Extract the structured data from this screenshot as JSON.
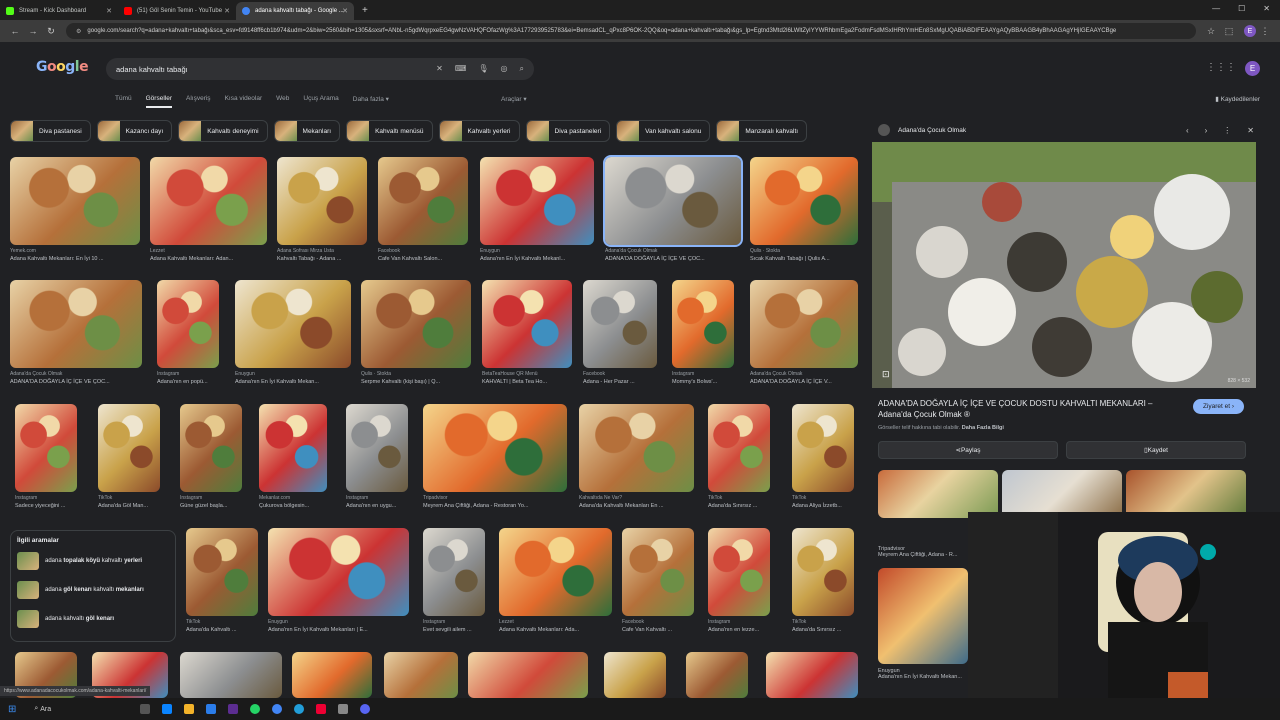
{
  "browser": {
    "tabs": [
      {
        "title": "Stream - Kick Dashboard",
        "color": "#53fc18",
        "active": false
      },
      {
        "title": "(51) Göl Senin Temin - YouTube",
        "color": "#ff0000",
        "active": false
      },
      {
        "title": "adana kahvaltı tabağı - Google ...",
        "color": "#4285f4",
        "active": true
      }
    ],
    "url": "google.com/search?q=adana+kahvaltı+tabağı&sca_esv=fd9148ff6cb1b974&udm=2&biw=2560&bih=1305&sxsrf=ANbL-n5gdWqrpxeEG4gwNzVAHQFOfazWg%3A1772939525783&ei=BemsadCL_qPxc8P6OK-2QQ&oq=adana+kahvaltı+tabağı&gs_lp=Egtnd3Mtd2l6LWltZyIYYWRhbmEga2FodmFsdMSxIHRhYmHEn8SxMgUQABiABDIFEAAYgAQyBBAAGB4yBhAAGAgYHjIGEAAYCBge",
    "new_tab": "+",
    "profile_letter": "E"
  },
  "google": {
    "logo": "Google",
    "query": "adana kahvaltı tabağı",
    "tabs": [
      "Tümü",
      "Görseller",
      "Alışveriş",
      "Kısa videolar",
      "Web",
      "Uçuş Arama",
      "Daha fazla ▾"
    ],
    "selected_tab": "Görseller",
    "tools": "Araçlar ▾",
    "saved": "Kaydedilenler",
    "avatar_letter": "E"
  },
  "chips": [
    "Diva pastanesi",
    "Kazancı dayı",
    "Kahvaltı deneyimi",
    "Mekanları",
    "Kahvaltı menüsü",
    "Kahvaltı yerleri",
    "Diva pastaneleri",
    "Van kahvaltı salonu",
    "Manzaralı kahvaltı"
  ],
  "results": [
    {
      "src": "Yemek.com",
      "title": "Adana Kahvaltı Mekanları: En İyi 10 ..."
    },
    {
      "src": "Lezzet",
      "title": "Adana Kahvaltı Mekanları: Adan..."
    },
    {
      "src": "Adana Sofrası Mirza Usta",
      "title": "Kahvaltı Tabağı - Adana ..."
    },
    {
      "src": "Facebook",
      "title": "Cafe Van Kahvaltı Salon..."
    },
    {
      "src": "Enuygun",
      "title": "Adana'nın En İyi Kahvaltı Mekanl..."
    },
    {
      "src": "Adana'da Çocuk Olmak",
      "title": "ADANA'DA DOĞAYLA İÇ İÇE VE ÇOC..."
    },
    {
      "src": "Qulis · Stokta",
      "title": "Sıcak Kahvaltı Tabağı | Qulis A..."
    },
    {
      "src": "Adana'da Çocuk Olmak",
      "title": "ADANA'DA DOĞAYLA İÇ İÇE VE ÇOC..."
    },
    {
      "src": "Instagram",
      "title": "Adana'nın en popü..."
    },
    {
      "src": "Enuygun",
      "title": "Adana'nın En İyi Kahvaltı Mekan..."
    },
    {
      "src": "Qulis · Stokta",
      "title": "Serpme Kahvaltı (kişi başı) | Q..."
    },
    {
      "src": "BetaTeaHouse QR Menü",
      "title": "KAHVALTI | Beta Tea Ho..."
    },
    {
      "src": "Facebook",
      "title": "Adana - Her Pazar ..."
    },
    {
      "src": "Instagram",
      "title": "Mommy's Bolws'..."
    },
    {
      "src": "Adana'da Çocuk Olmak",
      "title": "ADANA'DA DOĞAYLA İÇ İÇE V..."
    },
    {
      "src": "Instagram",
      "title": "Sadece yiyeceğini ..."
    },
    {
      "src": "TikTok",
      "title": "Adana'da Göl Man..."
    },
    {
      "src": "Instagram",
      "title": "Güne güzel başla..."
    },
    {
      "src": "Mekanlar.com",
      "title": "Çukurova bölgesin..."
    },
    {
      "src": "Instagram",
      "title": "Adana'nın en uygu..."
    },
    {
      "src": "Tripadvisor",
      "title": "Meyrem Ana Çiftliği, Adana - Restoran Yo..."
    },
    {
      "src": "Kahvaltıda Ne Var?",
      "title": "Adana'da Kahvaltı Mekanları En ..."
    },
    {
      "src": "TikTok",
      "title": "Adana'da Sınırsız ..."
    },
    {
      "src": "TikTok",
      "title": "Adana Aliya İzzetb..."
    },
    {
      "src": "TikTok",
      "title": "Adana'da Kahvaltı ..."
    },
    {
      "src": "Enuygun",
      "title": "Adana'nın En İyi Kahvaltı Mekanları | E..."
    },
    {
      "src": "Instagram",
      "title": "Evet sevgili ailem ..."
    },
    {
      "src": "Lezzet",
      "title": "Adana Kahvaltı Mekanları: Ada..."
    },
    {
      "src": "Facebook",
      "title": "Cafe Van Kahvaltı ..."
    },
    {
      "src": "Instagram",
      "title": "Adana'nın en lezze..."
    },
    {
      "src": "TikTok",
      "title": "Adana'da Sınırsız ..."
    }
  ],
  "related": {
    "heading": "İlgili aramalar",
    "items": [
      {
        "pre": "adana ",
        "bold": "topalak köyü",
        "post": " kahvaltı ",
        "bold2": "yerleri"
      },
      {
        "pre": "adana ",
        "bold": "göl kenarı",
        "post": " kahvaltı ",
        "bold2": "mekanları"
      },
      {
        "pre": "adana kahvaltı ",
        "bold": "göl kenarı",
        "post": "",
        "bold2": ""
      }
    ]
  },
  "panel": {
    "source": "Adana'da Çocuk Olmak",
    "title": "ADANA'DA DOĞAYLA İÇ İÇE VE ÇOCUK DOSTU KAHVALTI MEKANLARI – Adana'da Çocuk Olmak ®",
    "visit": "Ziyaret et ›",
    "note": "Görseller telif hakkına tabi olabilir.",
    "note_link": "Daha Fazla Bilgi",
    "share": "Paylaş",
    "save": "Kaydet",
    "size": "828 × 532",
    "sim_captions": [
      {
        "src": "Tripadvisor",
        "title": "Meyrem Ana Çiftliği, Adana - R..."
      },
      {
        "src": "Enuygun",
        "title": "Adana'nın En İyi Kahvaltı Mekan..."
      }
    ]
  },
  "status_url": "https://www.adanadacocukolmak.com/adana-kahvalti-mekanlari/",
  "taskbar": {
    "search": "Ara"
  }
}
